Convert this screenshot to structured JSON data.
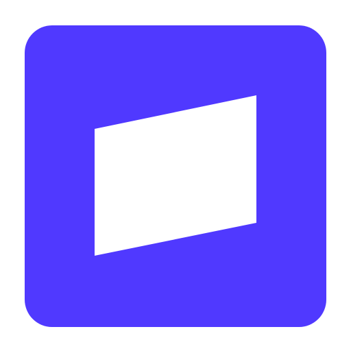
{
  "icon": {
    "semantic": "app-logo-icon",
    "colors": {
      "tile": "#5039FF",
      "mark": "#FFFFFF",
      "background": "#FFFFFF"
    }
  }
}
